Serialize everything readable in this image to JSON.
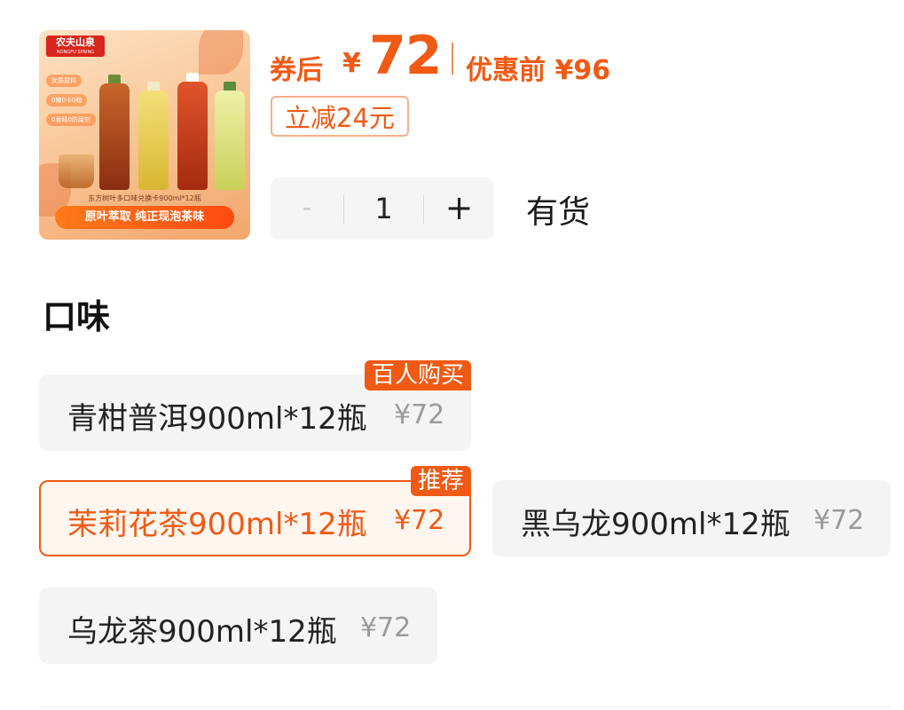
{
  "product": {
    "image": {
      "brand": "农夫山泉",
      "brand_en": "NONGFU SPRING",
      "chips": [
        "优质原料",
        "0糖0卡0脂",
        "0香精0防腐剂"
      ],
      "subtitle": "东方树叶多口味兑换卡900ml*12瓶",
      "banner": "原叶萃取 纯正现泡茶味"
    }
  },
  "price": {
    "label": "券后",
    "yen": "¥",
    "amount": "72",
    "original": "优惠前 ¥96",
    "discount": "立减24元",
    "accent_color": "#f05a14"
  },
  "quantity": {
    "minus": "-",
    "value": "1",
    "plus": "+",
    "stock": "有货"
  },
  "section": {
    "title": "口味"
  },
  "options": [
    {
      "name": "青柑普洱900ml*12瓶",
      "price": "¥72",
      "tag": "百人购买",
      "selected": false
    },
    {
      "name": "茉莉花茶900ml*12瓶",
      "price": "¥72",
      "tag": "推荐",
      "selected": true
    },
    {
      "name": "黑乌龙900ml*12瓶",
      "price": "¥72",
      "tag": "",
      "selected": false
    },
    {
      "name": "乌龙茶900ml*12瓶",
      "price": "¥72",
      "tag": "",
      "selected": false
    }
  ]
}
